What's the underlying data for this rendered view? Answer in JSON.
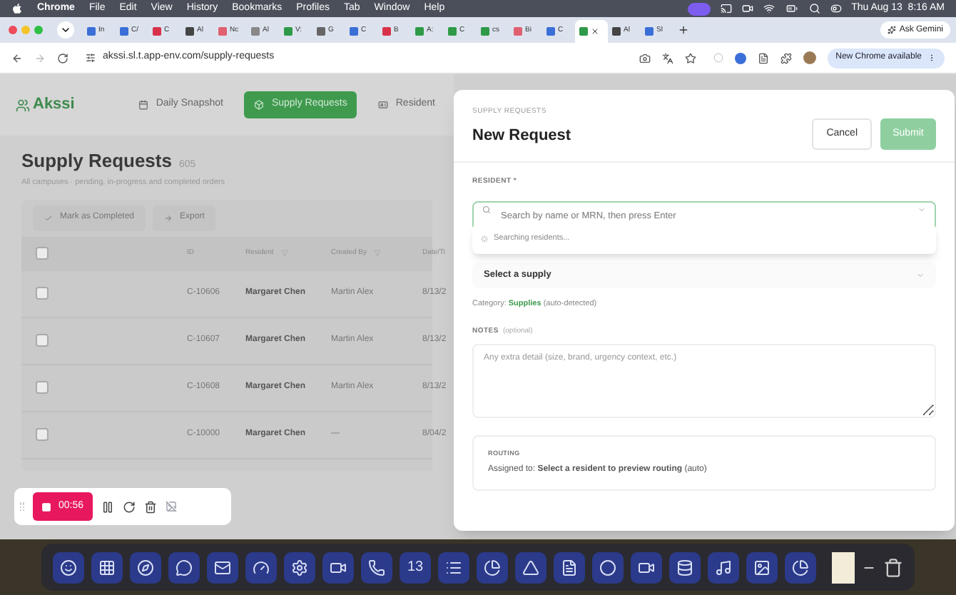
{
  "menubar": {
    "menus": [
      "Chrome",
      "File",
      "Edit",
      "View",
      "History",
      "Bookmarks",
      "Profiles",
      "Tab",
      "Window",
      "Help"
    ],
    "clock": "Thu Aug 13  8:16 AM"
  },
  "tabs": [
    {
      "label": "In",
      "selected": false,
      "color": "#3b6fd8"
    },
    {
      "label": "C/",
      "selected": false,
      "color": "#3b6fd8"
    },
    {
      "label": "C",
      "selected": false,
      "color": "#d8324a"
    },
    {
      "label": "Al",
      "selected": false,
      "color": "#444444"
    },
    {
      "label": "Nc",
      "selected": false,
      "color": "#e06070"
    },
    {
      "label": "Al",
      "selected": false,
      "color": "#888888"
    },
    {
      "label": "V:",
      "selected": false,
      "color": "#2e9a48"
    },
    {
      "label": "G",
      "selected": false,
      "color": "#666666"
    },
    {
      "label": "C",
      "selected": false,
      "color": "#3b6fd8"
    },
    {
      "label": "B",
      "selected": false,
      "color": "#d8324a"
    },
    {
      "label": "A:",
      "selected": false,
      "color": "#2e9a48"
    },
    {
      "label": "C",
      "selected": false,
      "color": "#2e9a48"
    },
    {
      "label": "cs",
      "selected": false,
      "color": "#2e9a48"
    },
    {
      "label": "Bi",
      "selected": false,
      "color": "#e06070"
    },
    {
      "label": "C",
      "selected": false,
      "color": "#3b6fd8"
    },
    {
      "selected": true,
      "color": "#2e9a48"
    },
    {
      "label": "Al",
      "selected": false,
      "color": "#444444"
    },
    {
      "label": "Sl",
      "selected": false,
      "color": "#3b6fd8"
    }
  ],
  "ask_button": "Ask Gemini",
  "address_bar": {
    "url": "akssi.sl.t.app-env.com/supply-requests",
    "update_button": "New Chrome available"
  },
  "app": {
    "logo": "Akssi",
    "nav": [
      {
        "label": "Daily Snapshot",
        "selected": false
      },
      {
        "label": "Supply Requests",
        "selected": true
      },
      {
        "label": "Resident",
        "selected": false
      }
    ],
    "title": "Supply Requests",
    "count": "605",
    "subtitle": "All campuses · pending, in-progress and completed orders",
    "actions": [
      "Mark as Completed",
      "Export"
    ],
    "table": {
      "all_checked": false,
      "columns": [
        "ID",
        "Resident",
        "Created By",
        "Date/Ti"
      ],
      "rows": [
        {
          "checked": false,
          "cells": [
            "C-10606",
            "Margaret Chen",
            "Martin Alex",
            "8/13/2"
          ]
        },
        {
          "checked": false,
          "cells": [
            "C-10607",
            "Margaret Chen",
            "Martin Alex",
            "8/13/2"
          ]
        },
        {
          "checked": false,
          "cells": [
            "C-10608",
            "Margaret Chen",
            "Martin Alex",
            "8/13/2"
          ]
        },
        {
          "checked": false,
          "cells": [
            "C-10000",
            "Margaret Chen",
            "—",
            "8/04/2"
          ]
        }
      ]
    }
  },
  "modal": {
    "eyebrow": "SUPPLY REQUESTS",
    "title": "New Request",
    "cancel": "Cancel",
    "submit": {
      "label": "Submit",
      "disabled": true
    },
    "resident_label": "RESIDENT *",
    "resident_search": {
      "placeholder": "Search by name or MRN, then press Enter"
    },
    "search_status": "Searching residents...",
    "supply_select": "Select a supply",
    "category": "Category: **Supplies** (auto-detected)",
    "notes_label": "NOTES",
    "notes_hint": "(optional)",
    "notes": {
      "placeholder": "Any extra detail (size, brand, urgency context, etc.)"
    },
    "routing": {
      "label": "ROUTING",
      "text": "Assigned to: **Select a resident to preview routing** (auto)"
    }
  },
  "recorder": {
    "time": "00:56"
  },
  "dock": {
    "calendar_day": "13"
  }
}
